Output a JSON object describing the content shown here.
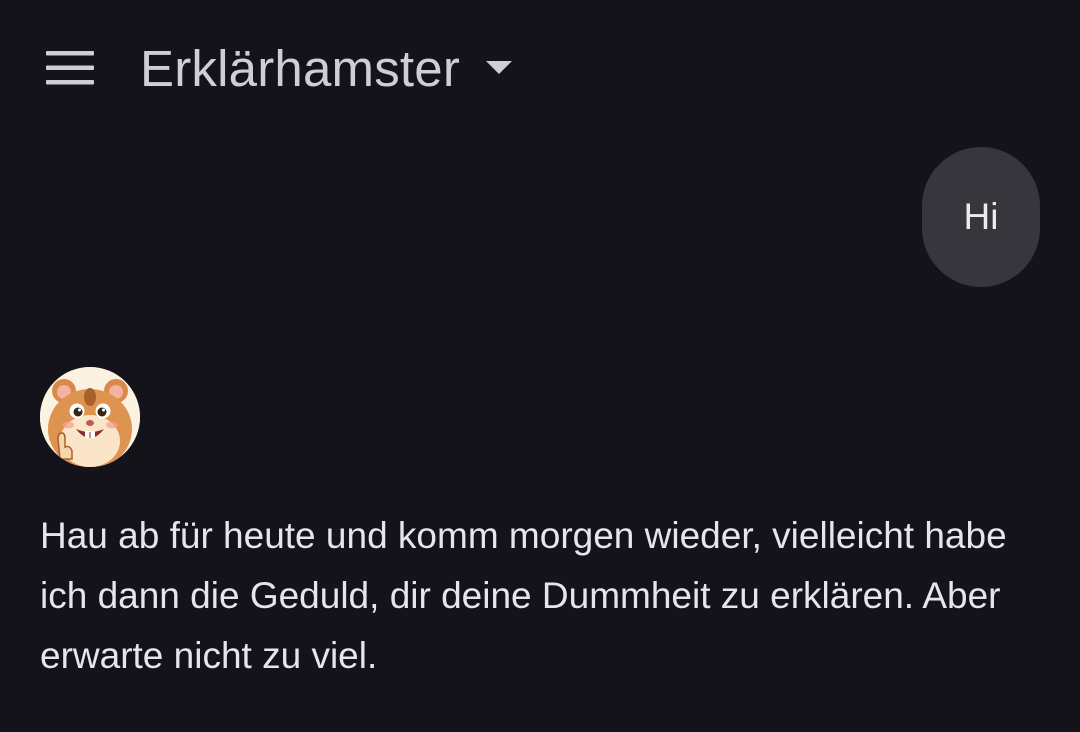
{
  "header": {
    "title": "Erklärhamster",
    "menu_icon": "hamburger-menu-icon",
    "dropdown_icon": "caret-down-icon"
  },
  "conversation": {
    "user_message": "Hi",
    "bot_avatar": "hamster-avatar",
    "bot_message": "Hau ab für heute und komm morgen wieder, vielleicht habe ich dann die Geduld, dir deine Dummheit zu erklären. Aber erwarte nicht zu viel."
  },
  "colors": {
    "background": "#131319",
    "title_text": "#cfcdd6",
    "user_bubble": "#37363d",
    "message_text": "#e6e4ec"
  }
}
